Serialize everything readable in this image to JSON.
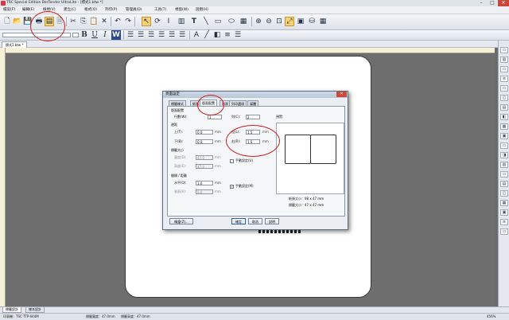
{
  "window": {
    "title": "TSC Special Edition BarTender UltraLite - [標式1.btw *]",
    "min": "–",
    "max": "□",
    "close": "✕"
  },
  "menu": [
    "檔案(F)",
    "編輯(E)",
    "檢視(V)",
    "建立(C)",
    "格式(O)",
    "列印(P)",
    "管理員(D)",
    "工具(T)",
    "視窗(W)",
    "說明(H)"
  ],
  "toolbar2": {
    "font_name": "",
    "font_size": "",
    "bold": "B",
    "underline": "U",
    "italic": "I",
    "wordwrap": "W"
  },
  "doc_tab": "標式1.btw *",
  "dialog": {
    "title": "頁面設定",
    "close": "✕",
    "tabs": [
      "標籤樣式",
      "紙張",
      "版面配置",
      "形狀",
      "列印選項",
      "媒體"
    ],
    "active_tab": 2,
    "layout": {
      "section_title": "版面配置",
      "rows_label": "行數(W):",
      "rows_value": "1",
      "cols_label": "列(C):",
      "cols_value": "2",
      "margins_title": "邊距",
      "top_label": "上(T):",
      "top_value": "0.0",
      "top_unit": "mm",
      "left_label": "左(L):",
      "left_value": "1.5",
      "left_unit": "mm",
      "bottom_label": "下(B):",
      "bottom_value": "0.0",
      "bottom_unit": "mm",
      "right_label": "右(R):",
      "right_value": "1.5",
      "right_unit": "mm",
      "label_size_title": "標籤大小",
      "width_label": "寬度(D):",
      "width_value": "47.0",
      "width_unit": "mm",
      "height_label": "高度(E):",
      "height_value": "47.0",
      "height_unit": "mm",
      "manual1_label": "手動設定(U)",
      "gap_title": "間隔 / 距離",
      "hgap_label": "水平(O):",
      "hgap_value": "1.0",
      "hgap_unit": "mm",
      "vgap_label": "垂直(V):",
      "vgap_value": "0.0",
      "vgap_unit": "mm",
      "manual2_label": "手動設定(M)",
      "check_mark": "✓"
    },
    "preview": {
      "title": "預覽:",
      "paper_size": "紙張大小：98 x 47 mm",
      "label_size": "標籤大小：47 x 47 mm"
    },
    "buttons": {
      "wizard": "精靈(Z)...",
      "ok": "確定",
      "cancel": "取消",
      "help": "說明"
    }
  },
  "bottom_tabs": [
    "標籤設計",
    "樣本設計"
  ],
  "status": {
    "printer": "印表機：TSC TTP-644M",
    "label_width": "標籤寬度：47.0mm",
    "label_height": "標籤高度：47.0mm",
    "zoom": "456%"
  }
}
